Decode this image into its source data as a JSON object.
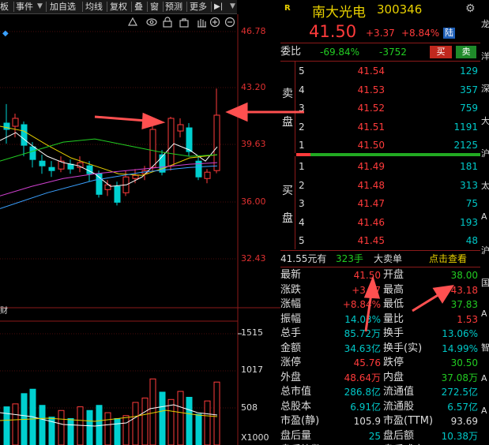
{
  "toolbar": {
    "items": [
      "板",
      "事件",
      "加自选",
      "均线",
      "复权",
      "叠",
      "窗",
      "预测",
      "更多"
    ]
  },
  "chart": {
    "price_ticks": [
      "46.78",
      "43.20",
      "39.63",
      "36.00",
      "32.43"
    ],
    "volume_ticks": [
      "1515",
      "1017",
      "508"
    ],
    "volume_unit": "X1000",
    "volume_label": "财"
  },
  "stock": {
    "badge": "R",
    "name": "南大光电",
    "code": "300346",
    "price": "41.50",
    "change": "+3.37",
    "change_pct": "+8.84%",
    "board_tag": "陆"
  },
  "weibi": {
    "label": "委比",
    "ratio": "-69.84%",
    "diff": "-3752",
    "buy_btn": "买",
    "sell_btn": "卖"
  },
  "sell_side_label": [
    "卖",
    "盘"
  ],
  "buy_side_label": [
    "买",
    "盘"
  ],
  "asks": [
    {
      "level": "5",
      "price": "41.54",
      "vol": "129"
    },
    {
      "level": "4",
      "price": "41.53",
      "vol": "357"
    },
    {
      "level": "3",
      "price": "41.52",
      "vol": "759"
    },
    {
      "level": "2",
      "price": "41.51",
      "vol": "1191"
    },
    {
      "level": "1",
      "price": "41.50",
      "vol": "2125"
    }
  ],
  "bids": [
    {
      "level": "1",
      "price": "41.49",
      "vol": "181"
    },
    {
      "level": "2",
      "price": "41.48",
      "vol": "313"
    },
    {
      "level": "3",
      "price": "41.47",
      "vol": "75"
    },
    {
      "level": "4",
      "price": "41.46",
      "vol": "193"
    },
    {
      "level": "5",
      "price": "41.45",
      "vol": "48"
    }
  ],
  "big_order": {
    "price": "41.55元有",
    "vol": "323手",
    "label": "大卖单",
    "link": "点击查看"
  },
  "stats": [
    {
      "l1": "最新",
      "v1": "41.50",
      "c1": "red",
      "l2": "开盘",
      "v2": "38.00",
      "c2": "grn"
    },
    {
      "l1": "涨跌",
      "v1": "+3.37",
      "c1": "red",
      "l2": "最高",
      "v2": "43.18",
      "c2": "red"
    },
    {
      "l1": "涨幅",
      "v1": "+8.84%",
      "c1": "red",
      "l2": "最低",
      "v2": "37.83",
      "c2": "grn"
    },
    {
      "l1": "振幅",
      "v1": "14.03%",
      "c1": "cyan",
      "l2": "量比",
      "v2": "1.53",
      "c2": "red"
    },
    {
      "l1": "总手",
      "v1": "85.72万",
      "c1": "cyan",
      "l2": "换手",
      "v2": "13.06%",
      "c2": "cyan"
    },
    {
      "l1": "金额",
      "v1": "34.63亿",
      "c1": "cyan",
      "l2": "换手(实)",
      "v2": "14.99%",
      "c2": "cyan"
    },
    {
      "l1": "涨停",
      "v1": "45.76",
      "c1": "red",
      "l2": "跌停",
      "v2": "30.50",
      "c2": "grn"
    },
    {
      "l1": "外盘",
      "v1": "48.64万",
      "c1": "red",
      "l2": "内盘",
      "v2": "37.08万",
      "c2": "grn"
    },
    {
      "l1": "总市值",
      "v1": "286.8亿",
      "c1": "cyan",
      "l2": "流通值",
      "v2": "272.5亿",
      "c2": "cyan"
    },
    {
      "l1": "总股本",
      "v1": "6.91亿",
      "c1": "cyan",
      "l2": "流通股",
      "v2": "6.57亿",
      "c2": "cyan"
    },
    {
      "l1": "市盈(静)",
      "v1": "105.9",
      "c1": "wht",
      "l2": "市盈(TTM)",
      "v2": "93.69",
      "c2": "wht"
    },
    {
      "l1": "盘后量",
      "v1": "25",
      "c1": "cyan",
      "l2": "盘后额",
      "v2": "10.38万",
      "c2": "cyan"
    },
    {
      "l1": "盘后笔数",
      "v1": "",
      "c1": "wht",
      "l2": "盘后成交",
      "v2": "",
      "c2": "wht"
    }
  ],
  "side_edge_chars": [
    "龙",
    "洋",
    "深",
    "大",
    "沪",
    "太",
    "A",
    "沪",
    "国",
    "A",
    "智",
    "A",
    "A"
  ],
  "colors": {
    "up": "#ff3b3b",
    "down": "#00d0d0",
    "buy_btn": "#c0281e",
    "sell_btn": "#1f8a2a",
    "annotation_arrow": "#ff5050"
  }
}
